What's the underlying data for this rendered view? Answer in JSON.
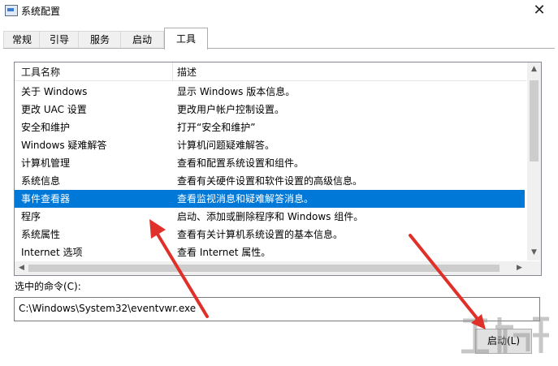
{
  "window": {
    "title": "系统配置",
    "close_glyph": "✕"
  },
  "tabs": [
    {
      "label": "常规"
    },
    {
      "label": "引导"
    },
    {
      "label": "服务"
    },
    {
      "label": "启动"
    },
    {
      "label": "工具",
      "active": true
    }
  ],
  "tools_table": {
    "columns": [
      "工具名称",
      "描述"
    ],
    "rows": [
      {
        "name": "关于 Windows",
        "desc": "显示 Windows 版本信息。"
      },
      {
        "name": "更改 UAC 设置",
        "desc": "更改用户帐户控制设置。"
      },
      {
        "name": "安全和维护",
        "desc": "打开“安全和维护”"
      },
      {
        "name": "Windows 疑难解答",
        "desc": "计算机问题疑难解答。"
      },
      {
        "name": "计算机管理",
        "desc": "查看和配置系统设置和组件。"
      },
      {
        "name": "系统信息",
        "desc": "查看有关硬件设置和软件设置的高级信息。"
      },
      {
        "name": "事件查看器",
        "desc": "查看监视消息和疑难解答消息。",
        "selected": true
      },
      {
        "name": "程序",
        "desc": "启动、添加或删除程序和 Windows 组件。"
      },
      {
        "name": "系统属性",
        "desc": "查看有关计算机系统设置的基本信息。"
      },
      {
        "name": "Internet 选项",
        "desc": "查看 Internet 属性。"
      }
    ]
  },
  "scrollbar": {
    "up": "▲",
    "down": "▼",
    "left": "◀",
    "right": "▶"
  },
  "selected_command": {
    "label": "选中的命令(C):",
    "value": "C:\\Windows\\System32\\eventvwr.exe"
  },
  "launch_button": {
    "label": "启动(L)"
  },
  "colors": {
    "selection": "#0078d7",
    "annotation_arrow": "#e0302a"
  }
}
